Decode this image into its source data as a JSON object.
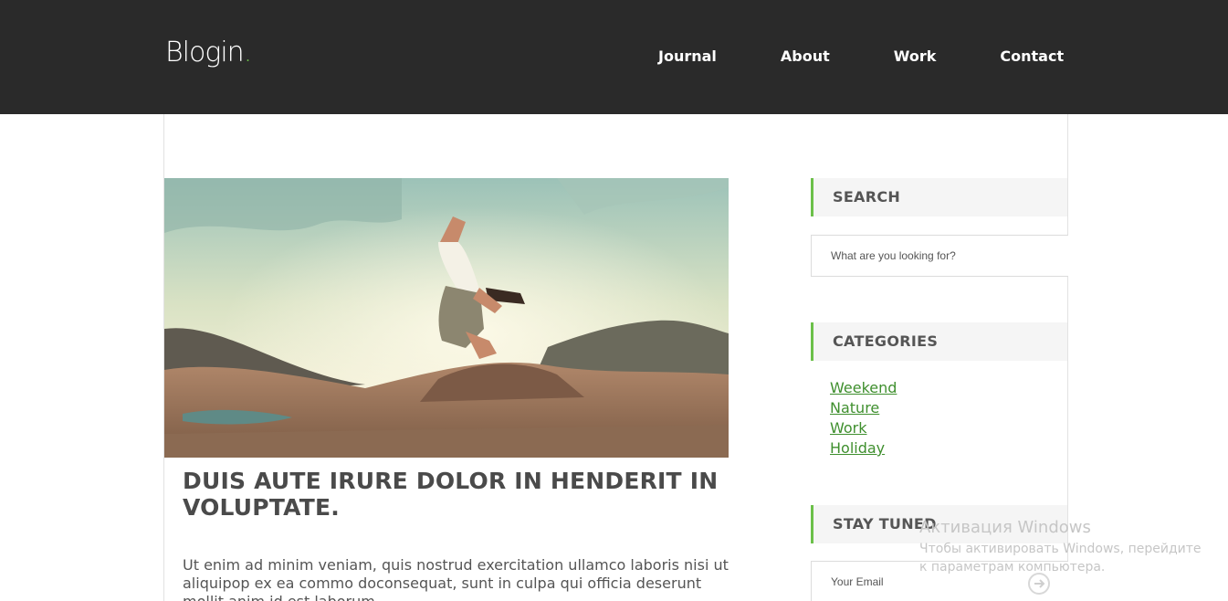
{
  "header": {
    "logo_text": "Blogin",
    "logo_dot": ".",
    "nav": [
      "Journal",
      "About",
      "Work",
      "Contact"
    ],
    "colors": {
      "bar": "#2a2a2a",
      "accent": "#6cc04a"
    }
  },
  "post": {
    "title": "DUIS AUTE IRURE DOLOR IN HENDERIT IN VOLUPTATE.",
    "body": "Ut enim ad minim veniam, quis nostrud exercitation ullamco laboris nisi ut aliquipop ex ea commo doconsequat, sunt in culpa qui officia deserunt mollit anim id est laborum."
  },
  "sidebar": {
    "search": {
      "heading": "SEARCH",
      "placeholder": "What are you looking for?"
    },
    "categories": {
      "heading": "CATEGORIES",
      "items": [
        "Weekend",
        "Nature",
        "Work",
        "Holiday"
      ]
    },
    "stay_tuned": {
      "heading": "STAY TUNED",
      "placeholder": "Your Email"
    }
  },
  "watermark": {
    "line1": "Активация Windows",
    "line2": "Чтобы активировать Windows, перейдите к параметрам компьютера."
  }
}
